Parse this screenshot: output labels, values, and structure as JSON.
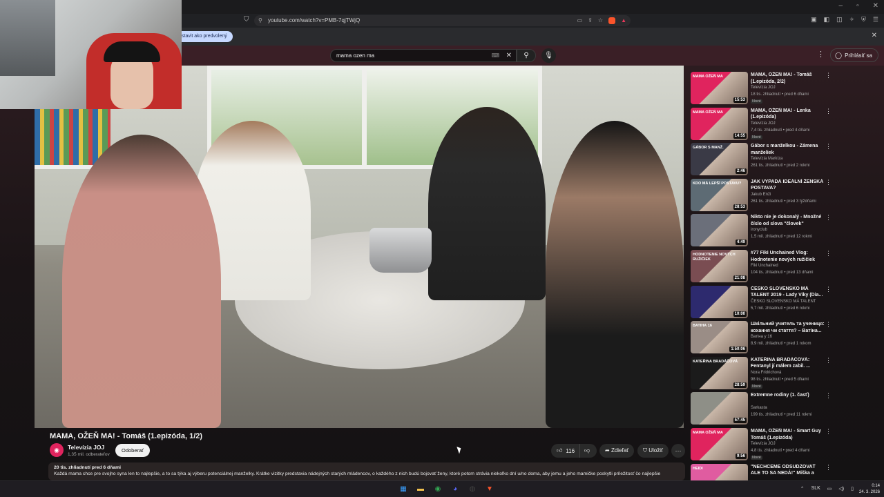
{
  "browser": {
    "url": "youtube.com/watch?v=PMB-7qjTWjQ",
    "infobar_button": "stavit ako predvolený",
    "icons": [
      "bookmark-icon",
      "lock-icon",
      "close-icon",
      "minimize-icon",
      "maximize-icon"
    ]
  },
  "header": {
    "search_value": "mama ozen ma",
    "signin_label": "Prihlásiť sa"
  },
  "video": {
    "title": "MAMA, OŽEŇ MA! - Tomáš (1.epizóda, 1/2)",
    "channel_name": "Televízia JOJ",
    "subscribers": "1,35 mil. odberateľov",
    "subscribe_label": "Odoberať",
    "likes": "116",
    "share_label": "Zdieľať",
    "save_label": "Uložiť",
    "description_meta": "20 tis. zhliadnutí  pred 6 dňami",
    "description_text": "Každá mama chce pre svojho syna len to najlepšie, a to sa týka aj výberu potenciálnej manželky. Krátke vizitky predstavia nádejných starých mládencov, o každého z nich budú bojovať ženy, ktoré potom strávia niekoľko dní u/no doma, aby jemu a jeho mamičke poskytli príležitosť čo najlepšie"
  },
  "sidebar": {
    "items": [
      {
        "title": "MAMA, OŽEŇ MA! - Tomáš (1.epizóda, 2/2)",
        "channel": "Televízia JOJ",
        "meta": "18 tis. zhliadnutí • pred 6 dňami",
        "badge": "Nové",
        "duration": "15:53",
        "thumb_color": "#e0245e",
        "thumb_text": "MAMA OŽEŇ MA"
      },
      {
        "title": "MAMA, OŽEŇ MA! - Lenka (1.epizóda)",
        "channel": "Televízia JOJ",
        "meta": "7,4 tis. zhliadnutí • pred 4 dňami",
        "badge": "Nové",
        "duration": "14:55",
        "thumb_color": "#e0245e",
        "thumb_text": "MAMA OŽEŇ MA"
      },
      {
        "title": "Gábor s manželkou - Zámena manželiek",
        "channel": "Televízia Markíza",
        "meta": "261 tis. zhliadnutí • pred 2 rokmi",
        "badge": "",
        "duration": "2:46",
        "thumb_color": "#3a3a46",
        "thumb_text": "GÁBOR S MANŽ."
      },
      {
        "title": "JAK VYPADÁ IDEÁLNÍ ŽENSKÁ POSTAVA?",
        "channel": "Jakub Enži",
        "meta": "261 tis. zhliadnutí • pred 3 týždňami",
        "badge": "",
        "duration": "28:53",
        "thumb_color": "#5d6b74",
        "thumb_text": "KDO MÁ LEPŠÍ POSTAVU?"
      },
      {
        "title": "Nikto nie je dokonalý - Množné číslo od slova \"človek\"",
        "channel": "ironyclub",
        "meta": "1,5 mil. zhliadnutí • pred 12 rokmi",
        "badge": "",
        "duration": "4:49",
        "thumb_color": "#6b6f7a",
        "thumb_text": ""
      },
      {
        "title": "#77 Fiki Unchained Vlog: Hodnotenie nových ružičiek",
        "channel": "Fiki Unchained",
        "meta": "104 tis. zhliadnutí • pred 13 dňami",
        "badge": "",
        "duration": "21:08",
        "thumb_color": "#7a4d52",
        "thumb_text": "HODNOTENIE NOVÝCH RUŽIČIEK"
      },
      {
        "title": "ČESKO SLOVENSKO MÁ TALENT 2019 - Lady Viky (Dia...",
        "channel": "ČESKO SLOVENSKO MÁ TALENT",
        "meta": "5,7 mil. zhliadnutí • pred 6 rokmi",
        "badge": "",
        "duration": "10:00",
        "thumb_color": "#2d2a6e",
        "thumb_text": ""
      },
      {
        "title": "Шкільний учитель та учениця: кохання чи стаття? – Ватіна...",
        "channel": "Ватіна у 16",
        "meta": "8,9 mil. zhliadnutí • pred 1 rokom",
        "badge": "",
        "duration": "1:50:06",
        "thumb_color": "#9a8d86",
        "thumb_text": "ВАТІНА 16"
      },
      {
        "title": "KATEŘINA BRADÁČOVÁ: Fentanyl jí málem zabil. ...",
        "channel": "Nora Fridrichová",
        "meta": "98 tis. zhliadnutí • pred 5 dňami",
        "badge": "Nové",
        "duration": "28:59",
        "thumb_color": "#1b1b1b",
        "thumb_text": "KATEŘINA BRADÁČOVÁ"
      },
      {
        "title": "Extremne rodiny (1. časť)",
        "channel": "Sarkasta",
        "meta": "199 tis. zhliadnutí • pred 11 rokmi",
        "badge": "",
        "duration": "57:45",
        "thumb_color": "#8e8f87",
        "thumb_text": ""
      },
      {
        "title": "MAMA, OŽEŇ MA! - Smart Guy Tomáš (1.epizóda)",
        "channel": "Televízia JOJ",
        "meta": "4,8 tis. zhliadnutí • pred 4 dňami",
        "badge": "Nové",
        "duration": "9:56",
        "thumb_color": "#e0245e",
        "thumb_text": "MAMA OŽEŇ MA"
      },
      {
        "title": "\"NECHCEME ODSUDZOVAŤ ALE TO SA NEDÁ!\" Miška a Heidi z ...",
        "channel": "",
        "meta": "",
        "badge": "",
        "duration": "",
        "thumb_color": "#e05ca0",
        "thumb_text": "HEIDI"
      }
    ]
  },
  "taskbar": {
    "tray_lang": "SLK",
    "time": "0:14",
    "date": "24. 3. 2026",
    "apps": [
      {
        "name": "windows-start-icon",
        "glyph": "▦",
        "color": "#3aa0ff"
      },
      {
        "name": "file-explorer-icon",
        "glyph": "▬",
        "color": "#f2c14e"
      },
      {
        "name": "chrome-icon",
        "glyph": "◉",
        "color": "#34a853"
      },
      {
        "name": "discord-icon",
        "glyph": "◕",
        "color": "#5865f2"
      },
      {
        "name": "obs-icon",
        "glyph": "◍",
        "color": "#444"
      },
      {
        "name": "brave-icon",
        "glyph": "▼",
        "color": "#fb542b"
      }
    ]
  }
}
